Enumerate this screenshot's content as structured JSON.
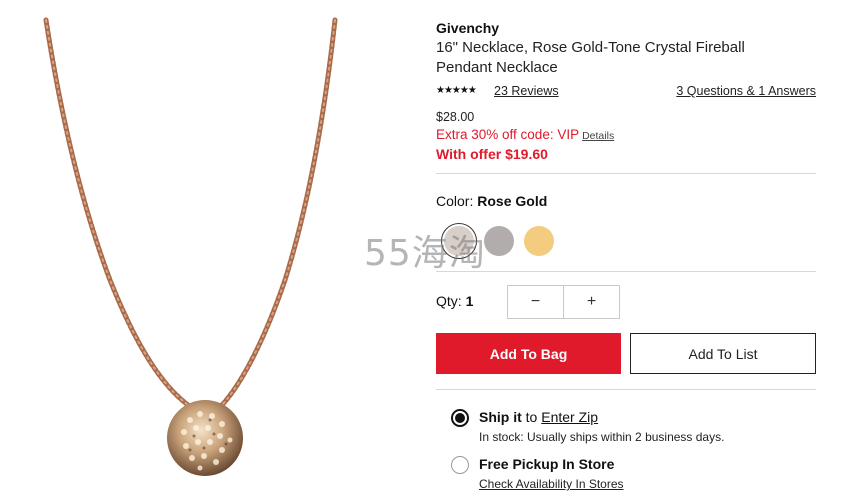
{
  "product": {
    "brand": "Givenchy",
    "title_line1": "16\" Necklace, Rose Gold-Tone Crystal Fireball",
    "title_line2": "Pendant Necklace",
    "image_icon": "necklace-product-image"
  },
  "reviews": {
    "stars": "★★★★★",
    "rating_icon": "star-rating-icon",
    "reviews_label": "23 Reviews",
    "qa_label": "3 Questions & 1 Answers"
  },
  "pricing": {
    "price": "$28.00",
    "extra_offer": "Extra 30% off code: VIP",
    "details_label": "Details",
    "with_offer": "With offer $19.60",
    "accent_color": "#e01a2b"
  },
  "color": {
    "label": "Color:",
    "selected": "Rose Gold",
    "swatches": [
      {
        "name": "Rose Gold",
        "hex": "#d9cfc9",
        "selected": true
      },
      {
        "name": "Silver",
        "hex": "#b2acac",
        "selected": false
      },
      {
        "name": "Gold",
        "hex": "#f3cc80",
        "selected": false
      }
    ]
  },
  "watermark": {
    "text": "55海淘"
  },
  "quantity": {
    "label": "Qty:",
    "value": "1",
    "minus": "−",
    "plus": "+"
  },
  "actions": {
    "add_to_bag": "Add To Bag",
    "add_to_list": "Add To List"
  },
  "fulfillment": {
    "ship_label": "Ship it",
    "ship_to": "to",
    "enter_zip": "Enter Zip",
    "stock_text": "In stock: Usually ships within 2 business days.",
    "pickup_label": "Free Pickup In Store",
    "availability_link": "Check Availability In Stores",
    "ship_selected": true
  }
}
